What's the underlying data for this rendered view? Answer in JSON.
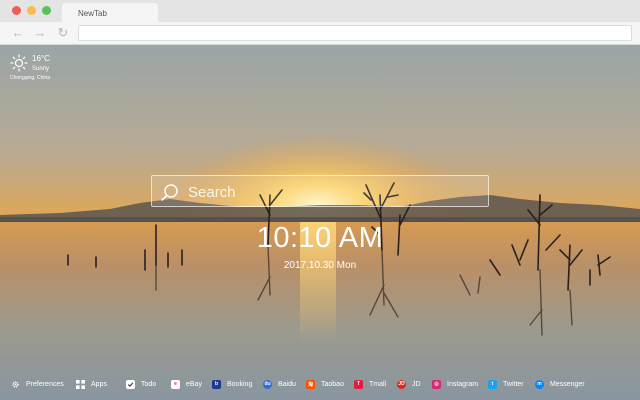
{
  "browser": {
    "tab_title": "NewTab",
    "nav": {
      "back": "←",
      "forward": "→",
      "reload": "↻"
    }
  },
  "weather": {
    "temperature": "16°C",
    "condition": "Sunny",
    "location": "Chongqing, China"
  },
  "search": {
    "placeholder": "Search"
  },
  "clock": {
    "time": "10:10 AM",
    "date": "2017.10.30 Mon"
  },
  "bottom_bar": {
    "items": [
      {
        "label": "Preferences",
        "icon": "gear-icon",
        "color": "#ffffff"
      },
      {
        "label": "Apps",
        "icon": "apps-grid-icon",
        "color": "#ffffff"
      },
      {
        "label": "Todo",
        "icon": "todo-check-icon",
        "color": "#ffffff"
      },
      {
        "label": "eBay",
        "icon": "ebay-icon",
        "color": "#ffffff",
        "glyph": "e"
      },
      {
        "label": "Booking",
        "icon": "booking-icon",
        "color": "#1a3b8f",
        "glyph": "b"
      },
      {
        "label": "Baidu",
        "icon": "baidu-icon",
        "color": "#2e6be6",
        "glyph": "du"
      },
      {
        "label": "Taobao",
        "icon": "taobao-icon",
        "color": "#ff5000",
        "glyph": "淘"
      },
      {
        "label": "Tmall",
        "icon": "tmall-icon",
        "color": "#e21b3c",
        "glyph": "T"
      },
      {
        "label": "JD",
        "icon": "jd-icon",
        "color": "#e1251b",
        "glyph": "JD"
      },
      {
        "label": "Instagram",
        "icon": "instagram-icon",
        "color": "#d62976",
        "glyph": "◎"
      },
      {
        "label": "Twitter",
        "icon": "twitter-icon",
        "color": "#1da1f2",
        "glyph": "t"
      },
      {
        "label": "Messenger",
        "icon": "messenger-icon",
        "color": "#0084ff",
        "glyph": "m"
      }
    ]
  }
}
